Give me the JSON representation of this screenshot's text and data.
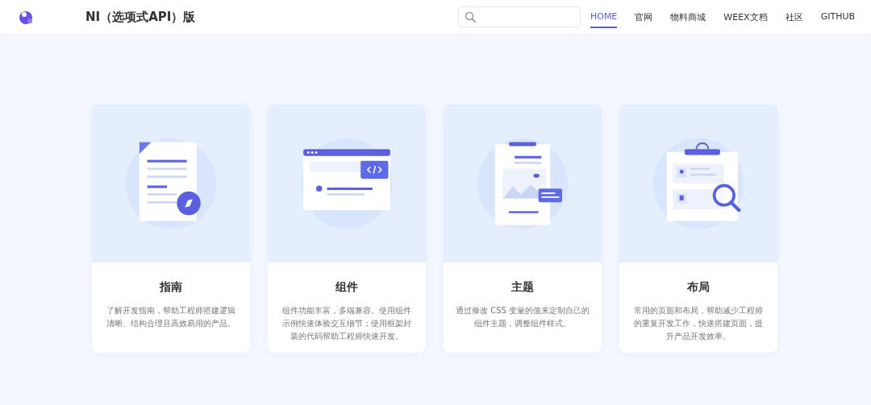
{
  "header": {
    "title": "NI（选项式API）版",
    "nav": [
      {
        "label": "HOME",
        "selected": true
      },
      {
        "label": "官网",
        "selected": false
      },
      {
        "label": "物料商城",
        "selected": false
      },
      {
        "label": "WEEX文档",
        "selected": false
      },
      {
        "label": "社区",
        "selected": false
      },
      {
        "label": "GITHUB",
        "selected": false
      }
    ]
  },
  "cards": [
    {
      "title": "指南",
      "description": "了解开发指南，帮助工程师搭建逻辑清晰、结构合理且高效易用的产品。"
    },
    {
      "title": "组件",
      "description": "组件功能丰富，多端兼容。使用组件示例快速体验交互细节；使用框架封装的代码帮助工程师快速开发。"
    },
    {
      "title": "主题",
      "description": "通过修改 CSS 变量的值来定制自己的组件主题，调整组件样式。"
    },
    {
      "title": "布局",
      "description": "常用的页面和布局，帮助减少工程师的重复开发工作，快速搭建页面，提升产品开发效率。"
    }
  ]
}
